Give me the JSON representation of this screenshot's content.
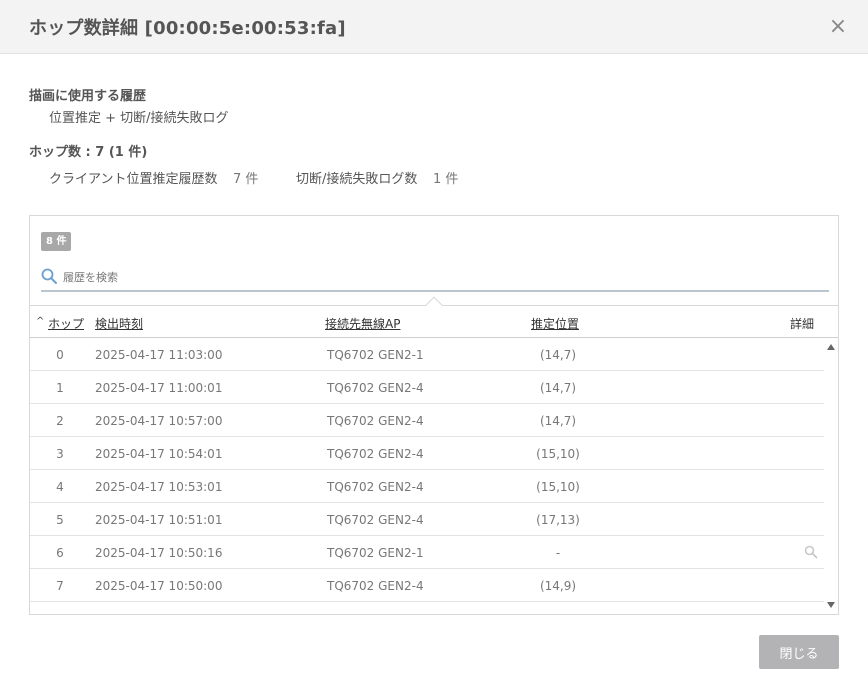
{
  "header": {
    "title": "ホップ数詳細 [00:00:5e:00:53:fa]",
    "close_glyph": "×"
  },
  "summary": {
    "history_label": "描画に使用する履歴",
    "history_value": "位置推定 + 切断/接続失敗ログ",
    "hops_label": "ホップ数 : 7 (1 件)",
    "client_history_label": "クライアント位置推定履歴数",
    "client_history_count": "7 件",
    "failure_log_label": "切断/接続失敗ログ数",
    "failure_log_count": "1 件"
  },
  "panel": {
    "count_badge": "8 件",
    "search_placeholder": "履歴を検索",
    "columns": {
      "sort_caret": "^",
      "hop": "ホップ",
      "time": "検出時刻",
      "ap": "接続先無線AP",
      "position": "推定位置",
      "detail": "詳細"
    },
    "rows": [
      {
        "hop": "0",
        "time": "2025-04-17 11:03:00",
        "ap": "TQ6702 GEN2-1",
        "position": "(14,7)",
        "has_detail": false
      },
      {
        "hop": "1",
        "time": "2025-04-17 11:00:01",
        "ap": "TQ6702 GEN2-4",
        "position": "(14,7)",
        "has_detail": false
      },
      {
        "hop": "2",
        "time": "2025-04-17 10:57:00",
        "ap": "TQ6702 GEN2-4",
        "position": "(14,7)",
        "has_detail": false
      },
      {
        "hop": "3",
        "time": "2025-04-17 10:54:01",
        "ap": "TQ6702 GEN2-4",
        "position": "(15,10)",
        "has_detail": false
      },
      {
        "hop": "4",
        "time": "2025-04-17 10:53:01",
        "ap": "TQ6702 GEN2-4",
        "position": "(15,10)",
        "has_detail": false
      },
      {
        "hop": "5",
        "time": "2025-04-17 10:51:01",
        "ap": "TQ6702 GEN2-4",
        "position": "(17,13)",
        "has_detail": false
      },
      {
        "hop": "6",
        "time": "2025-04-17 10:50:16",
        "ap": "TQ6702 GEN2-1",
        "position": "-",
        "has_detail": true
      },
      {
        "hop": "7",
        "time": "2025-04-17 10:50:00",
        "ap": "TQ6702 GEN2-4",
        "position": "(14,9)",
        "has_detail": false
      }
    ]
  },
  "footer": {
    "close_label": "閉じる"
  },
  "colors": {
    "header_bg": "#f3f3f4",
    "badge_bg": "#a8a8a8",
    "button_bg": "#b3b3b5",
    "search_underline": "#b9c6cf",
    "search_icon": "#6a9fd0"
  },
  "icons": {
    "search": "search-icon",
    "row_detail": "magnifier-icon",
    "close": "close-icon"
  }
}
